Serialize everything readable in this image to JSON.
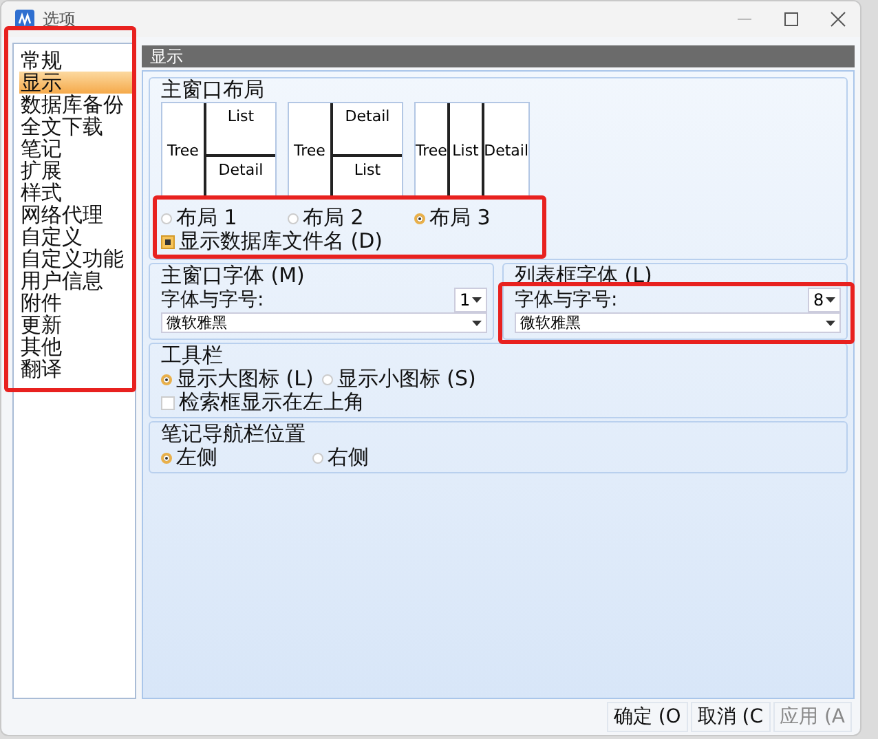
{
  "window": {
    "title": "选项"
  },
  "sidebar": {
    "highlighted": true,
    "items": [
      {
        "label": "常规",
        "selected": false
      },
      {
        "label": "显示",
        "selected": true
      },
      {
        "label": "数据库备份",
        "selected": false
      },
      {
        "label": "全文下载",
        "selected": false
      },
      {
        "label": "笔记",
        "selected": false
      },
      {
        "label": "扩展",
        "selected": false
      },
      {
        "label": "样式",
        "selected": false
      },
      {
        "label": "网络代理",
        "selected": false
      },
      {
        "label": "自定义",
        "selected": false
      },
      {
        "label": "自定义功能",
        "selected": false
      },
      {
        "label": "用户信息",
        "selected": false
      },
      {
        "label": "附件",
        "selected": false
      },
      {
        "label": "更新",
        "selected": false
      },
      {
        "label": "其他",
        "selected": false
      },
      {
        "label": "翻译",
        "selected": false
      }
    ]
  },
  "panel": {
    "title": "显示"
  },
  "layout_group": {
    "title": "主窗口布局",
    "highlighted": true,
    "previews": [
      {
        "kind": "stacked",
        "left": "Tree",
        "top": "List",
        "bottom": "Detail"
      },
      {
        "kind": "stacked",
        "left": "Tree",
        "top": "Detail",
        "bottom": "List"
      },
      {
        "kind": "columns",
        "columns": [
          "Tree",
          "List",
          "Detail"
        ]
      }
    ],
    "options": [
      {
        "label": "布局 1",
        "selected": false
      },
      {
        "label": "布局 2",
        "selected": false
      },
      {
        "label": "布局 3",
        "selected": true
      }
    ],
    "checkbox": {
      "label": "显示数据库文件名 (D)",
      "checked": true
    }
  },
  "font_groups": [
    {
      "title": "主窗口字体 (M)",
      "label": "字体与字号:",
      "size": "1",
      "font": "微软雅黑",
      "highlighted": false
    },
    {
      "title": "列表框字体 (L)",
      "label": "字体与字号:",
      "size": "8",
      "font": "微软雅黑",
      "highlighted": true
    }
  ],
  "toolbar_group": {
    "title": "工具栏",
    "options": [
      {
        "label": "显示大图标 (L)",
        "selected": true
      },
      {
        "label": "显示小图标 (S)",
        "selected": false
      }
    ],
    "checkbox": {
      "label": "检索框显示在左上角",
      "checked": false
    }
  },
  "nav_group": {
    "title": "笔记导航栏位置",
    "options": [
      {
        "label": "左侧",
        "selected": true
      },
      {
        "label": "右侧",
        "selected": false
      }
    ]
  },
  "buttons": [
    {
      "label": "确定 (O",
      "disabled": false
    },
    {
      "label": "取消 (C",
      "disabled": false
    },
    {
      "label": "应用 (A",
      "disabled": true
    }
  ]
}
